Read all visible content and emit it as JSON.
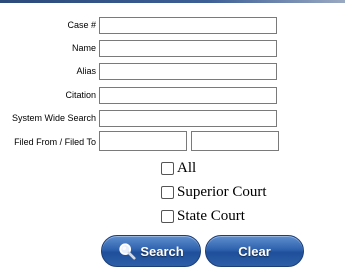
{
  "form": {
    "fields": [
      {
        "label": "Case #",
        "value": ""
      },
      {
        "label": "Name",
        "value": ""
      },
      {
        "label": "Alias",
        "value": ""
      },
      {
        "label": "Citation",
        "value": ""
      },
      {
        "label": "System Wide Search",
        "value": ""
      }
    ],
    "filed": {
      "label": "Filed From / Filed To",
      "from_value": "",
      "to_value": ""
    }
  },
  "filters": [
    {
      "label": "All",
      "checked": false
    },
    {
      "label": "Superior Court",
      "checked": false
    },
    {
      "label": "State Court",
      "checked": false
    }
  ],
  "buttons": {
    "search": "Search",
    "clear": "Clear"
  },
  "icons": {
    "search": "magnifier-icon"
  }
}
